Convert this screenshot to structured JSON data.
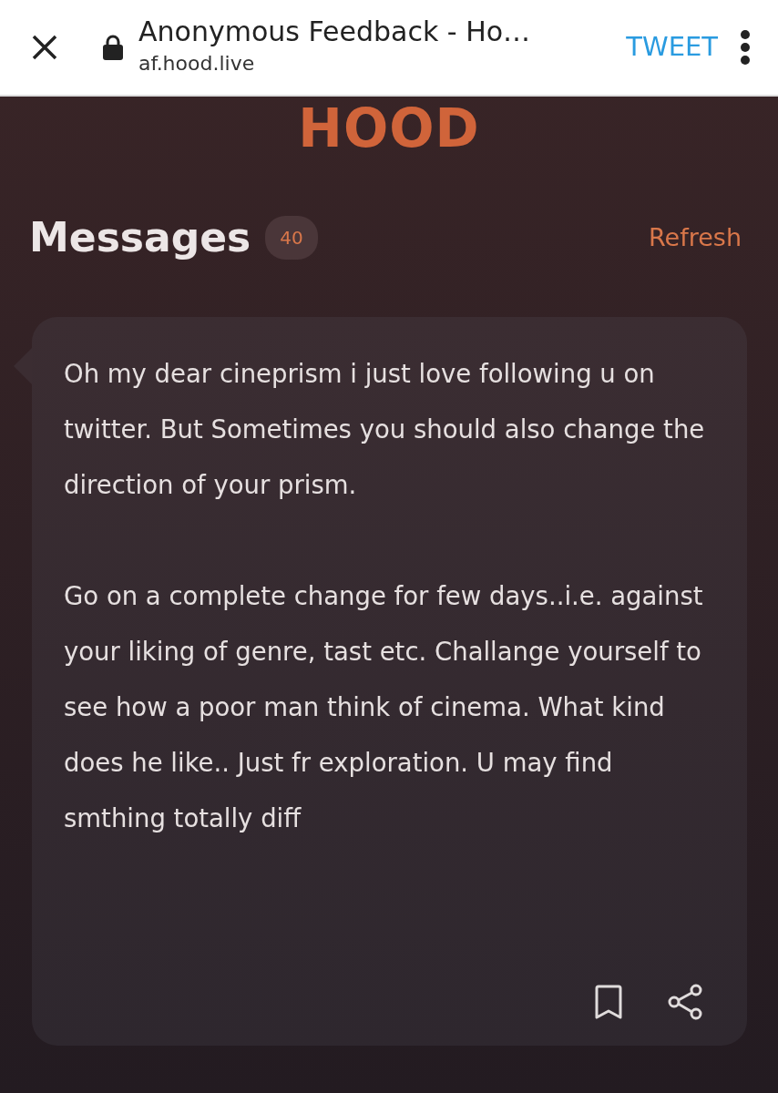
{
  "browser_bar": {
    "title": "Anonymous Feedback - Ho…",
    "url": "af.hood.live",
    "action": "TWEET"
  },
  "logo": "HOOD",
  "header": {
    "title": "Messages",
    "count": "40",
    "refresh": "Refresh"
  },
  "messages": [
    {
      "paragraphs": [
        "Oh my dear cineprism i just love following u on twitter. But Sometimes you should also change the direction of your prism.",
        "Go on a complete change for few days..i.e. against your liking of genre, tast etc. Challange yourself to see how a poor man think of cinema. What kind does he like.. Just fr exploration. U may find smthing totally diff"
      ]
    }
  ]
}
